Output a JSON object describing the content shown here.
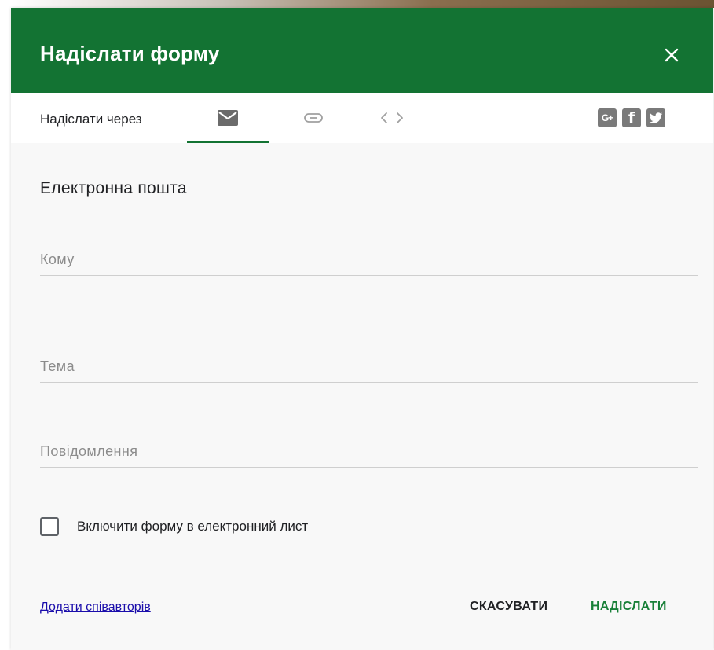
{
  "header": {
    "title": "Надіслати форму",
    "close_icon": "close-icon",
    "color": "#137333"
  },
  "tabs": {
    "send_via_label": "Надіслати через",
    "items": [
      {
        "icon": "envelope-icon",
        "active": true
      },
      {
        "icon": "link-icon",
        "active": false
      },
      {
        "icon": "embed-code-icon",
        "active": false
      }
    ],
    "social": [
      {
        "icon": "google-plus-icon",
        "glyph": "G+"
      },
      {
        "icon": "facebook-icon",
        "glyph": "f"
      },
      {
        "icon": "twitter-icon"
      }
    ]
  },
  "form": {
    "section_title": "Електронна пошта",
    "to_placeholder": "Кому",
    "to_value": "",
    "subject_placeholder": "Тема",
    "subject_value": "",
    "message_placeholder": "Повідомлення",
    "message_value": "",
    "include_form_label": "Включити форму в електронний лист",
    "include_form_checked": false
  },
  "footer": {
    "add_collaborators": "Додати співавторів",
    "cancel": "СКАСУВАТИ",
    "send": "НАДІСЛАТИ"
  }
}
